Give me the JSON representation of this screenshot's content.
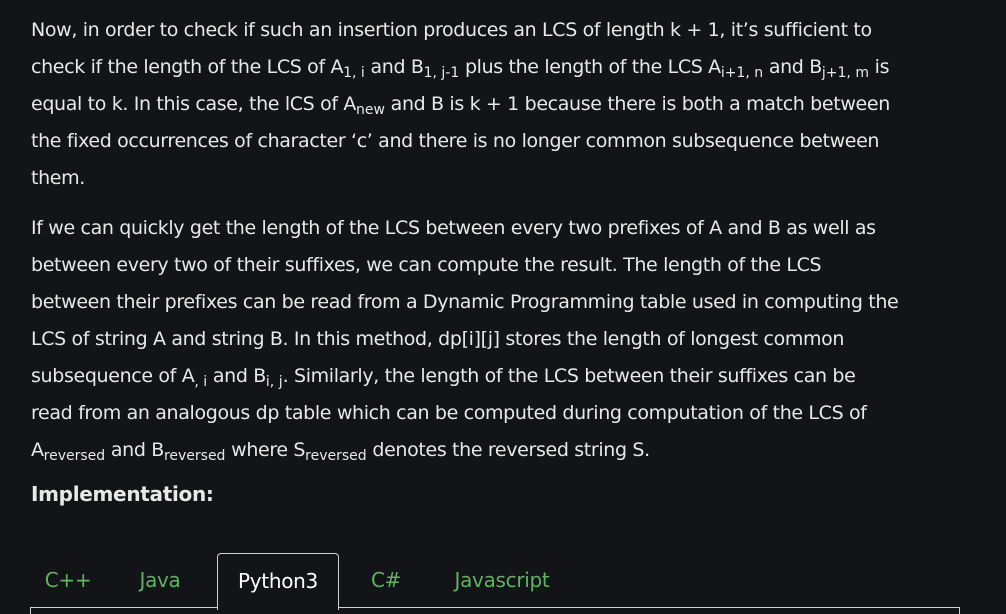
{
  "paragraph1": {
    "l1": "Now, in order to check if such an insertion produces an LCS of length k + 1, it’s sufficient to",
    "l2_a": "check if the length of the LCS of A",
    "l2_sub1": "1, i",
    "l2_b": " and B",
    "l2_sub2": "1, j-1",
    "l2_c": " plus the length of the LCS A",
    "l2_sub3": "i+1, n",
    "l2_d": " and B",
    "l2_sub4": "j+1, m",
    "l2_e": " is",
    "l3_a": "equal to k. In this case, the lCS of A",
    "l3_sub1": "new",
    "l3_b": " and B is k + 1 because there is both a match between",
    "l4": "the fixed occurrences of character ‘c’ and there is no longer common subsequence between",
    "l5": "them."
  },
  "paragraph2": {
    "l1": "If we can quickly get the length of the LCS between every two prefixes of A and B as well as",
    "l2": "between every two of their suffixes, we can compute the result. The length of the LCS",
    "l3": "between their prefixes can be read from a Dynamic Programming table used in computing the",
    "l4": "LCS of string A and string B. In this method, dp[i][j] stores the length of longest common",
    "l5_a": "subsequence of A",
    "l5_sub1": ", i",
    "l5_b": " and B",
    "l5_sub2": "i, j",
    "l5_c": ". Similarly, the length of the LCS between their suffixes can be",
    "l6": "read from an analogous dp table which can be computed during computation of the LCS of",
    "l7_a": "A",
    "l7_sub1": "reversed",
    "l7_b": " and B",
    "l7_sub2": "reversed",
    "l7_c": " where S",
    "l7_sub3": "reversed",
    "l7_d": " denotes the reversed string S."
  },
  "heading": "Implementation:",
  "tabs": [
    {
      "label": "C++",
      "active": false
    },
    {
      "label": "Java",
      "active": false
    },
    {
      "label": "Python3",
      "active": true
    },
    {
      "label": "C#",
      "active": false
    },
    {
      "label": "Javascript",
      "active": false
    }
  ],
  "colors": {
    "background": "#131417",
    "text": "#e8e8e8",
    "tab_inactive": "#5fb35f",
    "tab_active": "#ffffff",
    "border": "#d0d0d0"
  }
}
